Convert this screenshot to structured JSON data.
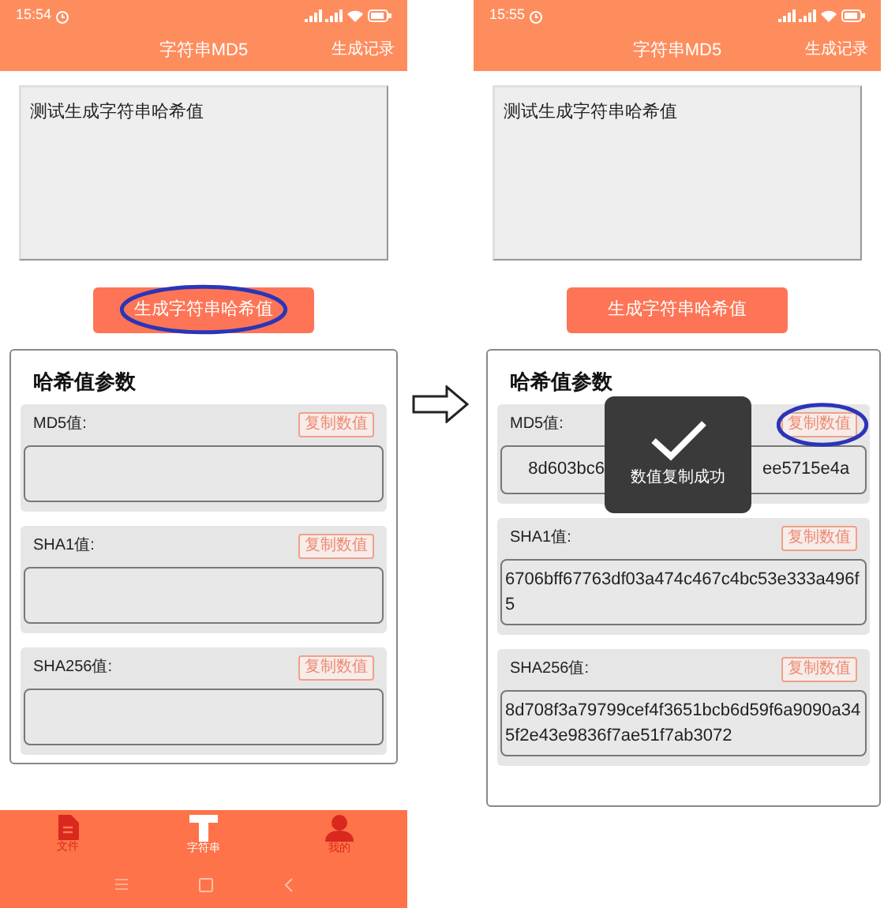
{
  "screens": [
    {
      "status_time": "15:54",
      "title": "字符串MD5",
      "action": "生成记录",
      "input_text": "测试生成字符串哈希值",
      "generate_button": "生成字符串哈希值",
      "generate_circled": true,
      "section_title": "哈希值参数",
      "hashes": [
        {
          "label": "MD5值:",
          "copy_button": "复制数值",
          "circled": false
        },
        {
          "label": "SHA1值:",
          "copy_button": "复制数值",
          "circled": false
        },
        {
          "label": "SHA256值:",
          "copy_button": "复制数值",
          "circled": false
        }
      ],
      "tabs": [
        {
          "label": "文件",
          "kind": "file",
          "selected": false
        },
        {
          "label": "字符串",
          "kind": "text",
          "selected": true
        },
        {
          "label": "我的",
          "kind": "user",
          "selected": false
        }
      ]
    },
    {
      "status_time": "15:55",
      "title": "字符串MD5",
      "action": "生成记录",
      "input_text": "测试生成字符串哈希值",
      "generate_button": "生成字符串哈希值",
      "generate_circled": false,
      "section_title": "哈希值参数",
      "hashes": [
        {
          "label": "MD5值:",
          "copy_button": "复制数值",
          "circled": true,
          "value_parts": [
            "8d603bc6",
            "ee5715e4a"
          ]
        },
        {
          "label": "SHA1值:",
          "copy_button": "复制数值",
          "circled": false,
          "value": "6706bff67763df03a474c467c4bc53e333a496f5"
        },
        {
          "label": "SHA256值:",
          "copy_button": "复制数值",
          "circled": false,
          "value": "8d708f3a79799cef4f3651bcb6d59f6a9090a345f2e43e9836f7ae51f7ab3072"
        }
      ],
      "toast": "数值复制成功"
    }
  ]
}
